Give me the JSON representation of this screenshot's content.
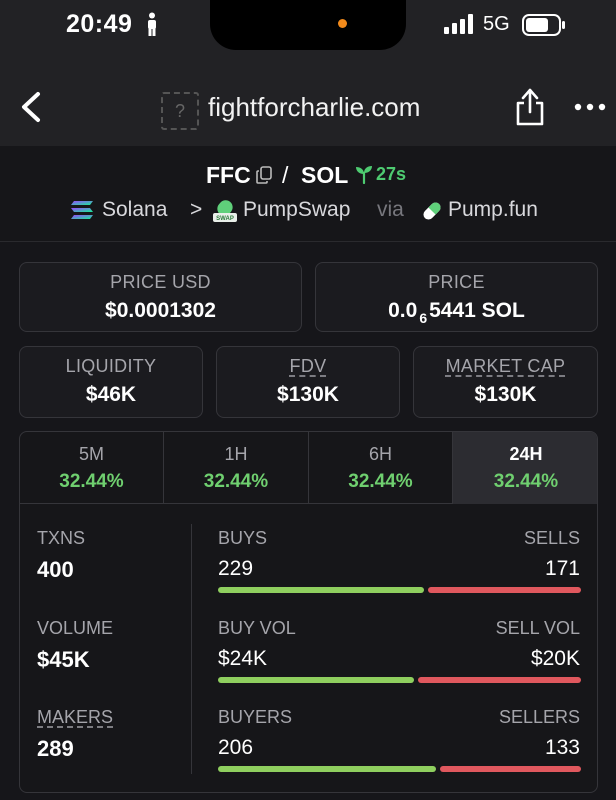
{
  "status_bar": {
    "time": "20:49",
    "network": "5G",
    "icons": [
      "person-icon",
      "signal-icon",
      "battery-icon"
    ]
  },
  "browser": {
    "url": "fightforcharlie.com",
    "favicon_placeholder": "?",
    "icons": [
      "back-icon",
      "share-icon",
      "more-icon"
    ]
  },
  "pair": {
    "base": "FFC",
    "separator": "/",
    "quote": "SOL",
    "age": "27s",
    "chain": "Solana",
    "chevron": ">",
    "dex": "PumpSwap",
    "via": "via",
    "launchpad": "Pump.fun"
  },
  "cards": {
    "price_usd": {
      "label": "PRICE USD",
      "value": "$0.0001302"
    },
    "price_native": {
      "label": "PRICE",
      "prefix": "0.0",
      "subscript": "6",
      "suffix": "5441 SOL"
    },
    "liquidity": {
      "label": "LIQUIDITY",
      "value": "$46K"
    },
    "fdv": {
      "label": "FDV",
      "value": "$130K"
    },
    "market_cap": {
      "label": "MARKET CAP",
      "value": "$130K"
    }
  },
  "timeframes": [
    {
      "label": "5M",
      "change": "32.44%"
    },
    {
      "label": "1H",
      "change": "32.44%"
    },
    {
      "label": "6H",
      "change": "32.44%"
    },
    {
      "label": "24H",
      "change": "32.44%"
    }
  ],
  "active_timeframe": "24H",
  "stats": {
    "txns": {
      "label": "TXNS",
      "value": "400"
    },
    "volume": {
      "label": "VOLUME",
      "value": "$45K"
    },
    "makers": {
      "label": "MAKERS",
      "value": "289"
    },
    "buys": {
      "label": "BUYS",
      "value": "229",
      "sell_label": "SELLS",
      "sell_value": "171",
      "buy_fraction": 0.5725
    },
    "buy_vol": {
      "label": "BUY VOL",
      "value": "$24K",
      "sell_label": "SELL VOL",
      "sell_value": "$20K",
      "buy_fraction": 0.5455
    },
    "buyers": {
      "label": "BUYERS",
      "value": "206",
      "sell_label": "SELLERS",
      "sell_value": "133",
      "buy_fraction": 0.6077
    }
  },
  "colors": {
    "positive": "#6fcf6f",
    "buy_bar": "#8fcf5f",
    "sell_bar": "#e0585e",
    "age_green": "#4ecb71",
    "island_dot": "#f28a1b"
  }
}
